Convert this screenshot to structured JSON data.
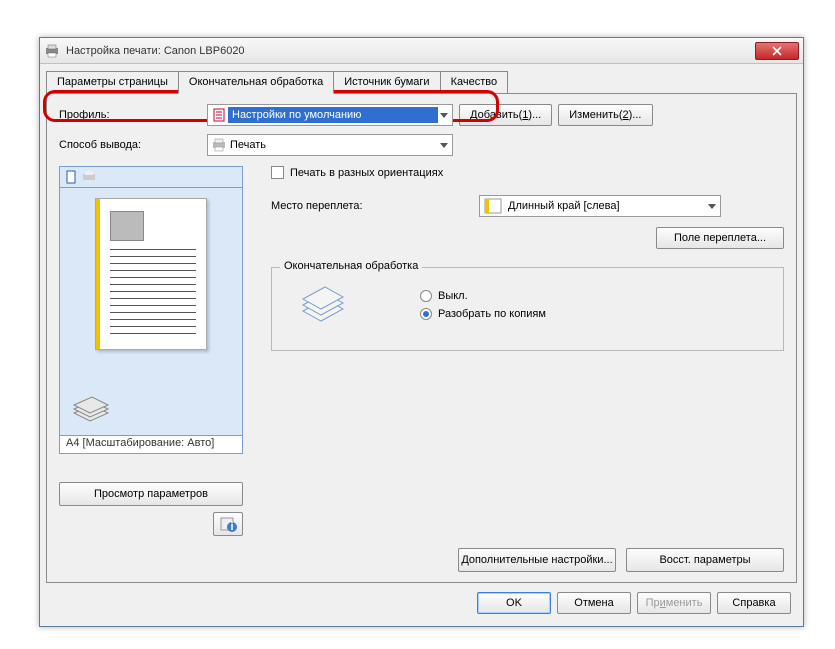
{
  "window": {
    "title": "Настройка печати: Canon LBP6020"
  },
  "tabs": {
    "page_params": "Параметры страницы",
    "finishing": "Окончательная обработка",
    "paper_source": "Источник бумаги",
    "quality": "Качество"
  },
  "profile": {
    "label": "Профиль:",
    "value": "Настройки по умолчанию",
    "add_prefix": "Добавить(",
    "add_hot": "1",
    "add_suffix": ")...",
    "edit_prefix": "Изменить(",
    "edit_hot": "2",
    "edit_suffix": ")..."
  },
  "output": {
    "label": "Способ вывода:",
    "value": "Печать"
  },
  "preview": {
    "caption": "A4 [Масштабирование: Авто]",
    "view_params": "Просмотр параметров"
  },
  "options": {
    "diff_orient": "Печать в разных ориентациях",
    "binding_label": "Место переплета:",
    "binding_value": "Длинный край [слева]",
    "binding_margin": "Поле переплета..."
  },
  "finishing_group": {
    "legend": "Окончательная обработка",
    "off": "Выкл.",
    "collate": "Разобрать по копиям"
  },
  "bottom": {
    "advanced_pre": "Д",
    "advanced_rest": "ополнительные настройки...",
    "restore": "Восст. параметры"
  },
  "dialog": {
    "ok": "OK",
    "cancel": "Отмена",
    "apply_pre": "Пр",
    "apply_hot": "и",
    "apply_post": "менить",
    "help": "Справка"
  }
}
